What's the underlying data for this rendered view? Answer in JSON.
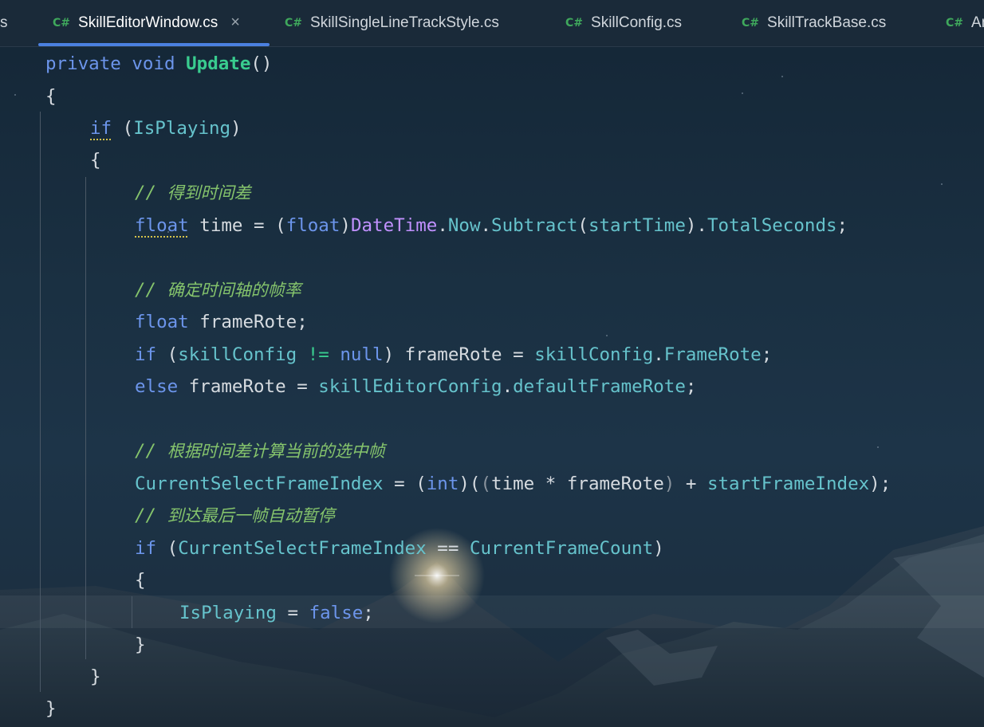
{
  "tabs": [
    {
      "lang": "C#",
      "name": "SkillEditorWindow.cs",
      "active": true,
      "close": "×"
    },
    {
      "lang": "C#",
      "name": "SkillSingleLineTrackStyle.cs"
    },
    {
      "lang": "C#",
      "name": "SkillConfig.cs"
    },
    {
      "lang": "C#",
      "name": "SkillTrackBase.cs"
    },
    {
      "lang": "C#",
      "name": "An"
    }
  ],
  "partial_tab_left": "s",
  "code": {
    "l1": {
      "a": "private",
      "b": "void",
      "c": "Update",
      "d": "()"
    },
    "l2": "{",
    "l3": {
      "a": "if",
      "b": " (",
      "c": "IsPlaying",
      "d": ")"
    },
    "l4": "{",
    "l5": {
      "a": "// ",
      "b": "得到时间差"
    },
    "l6": {
      "a": "float",
      "b": " time = (",
      "c": "float",
      "d": ")",
      "e": "DateTime",
      "f": ".",
      "g": "Now",
      "h": ".",
      "i": "Subtract",
      "j": "(",
      "k": "startTime",
      "l": ").",
      "m": "TotalSeconds",
      "n": ";"
    },
    "l8": {
      "a": "// ",
      "b": "确定时间轴的帧率"
    },
    "l9": {
      "a": "float",
      "b": " frameRote;"
    },
    "l10": {
      "a": "if",
      "b": " (",
      "c": "skillConfig",
      "d": " != ",
      "e": "null",
      "f": ") frameRote = ",
      "g": "skillConfig",
      "h": ".",
      "i": "FrameRote",
      "j": ";"
    },
    "l11": {
      "a": "else",
      "b": " frameRote = ",
      "c": "skillEditorConfig",
      "d": ".",
      "e": "defaultFrameRote",
      "f": ";"
    },
    "l13": {
      "a": "// ",
      "b": "根据时间差计算当前的选中帧"
    },
    "l14": {
      "a": "CurrentSelectFrameIndex",
      "b": " = (",
      "c": "int",
      "d": ")(",
      "e": "(",
      "f": "time * frameRote",
      "g": ")",
      "h": " + ",
      "i": "startFrameIndex",
      "j": ");"
    },
    "l15": {
      "a": "// ",
      "b": "到达最后一帧自动暂停"
    },
    "l16": {
      "a": "if",
      "b": " (",
      "c": "CurrentSelectFrameIndex",
      "d": " == ",
      "e": "CurrentFrameCount",
      "f": ")"
    },
    "l17": "{",
    "l18": {
      "a": "IsPlaying",
      "b": " = ",
      "c": "false",
      "d": ";"
    },
    "l19": "}",
    "l20": "}",
    "l21": "}"
  },
  "colors": {
    "keyword": "#6c95eb",
    "method": "#39cc8f",
    "comment": "#85c46c",
    "field": "#66c3cc",
    "type": "#c191ff",
    "text": "#d6dbe0",
    "tab_accent": "#4b80e0"
  }
}
